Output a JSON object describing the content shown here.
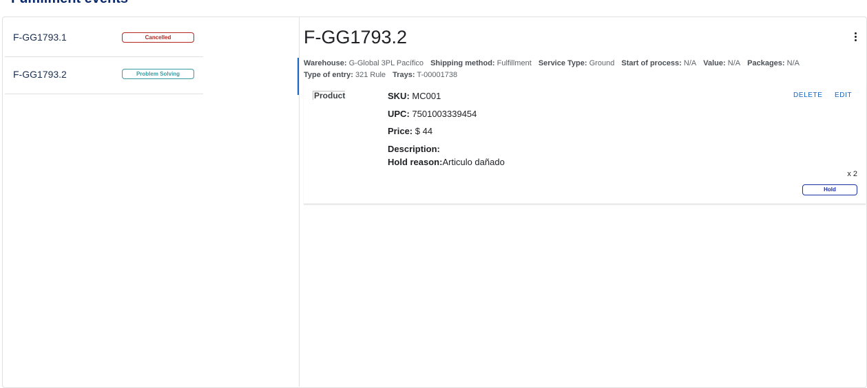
{
  "page": {
    "title": "Fulfillment events"
  },
  "list": {
    "items": [
      {
        "id": "F-GG1793.1",
        "status": "Cancelled"
      },
      {
        "id": "F-GG1793.2",
        "status": "Problem Solving"
      }
    ]
  },
  "detail": {
    "title": "F-GG1793.2",
    "meta": {
      "warehouse_label": "Warehouse:",
      "warehouse": "G-Global 3PL Pacífico",
      "shipping_label": "Shipping method:",
      "shipping": "Fulfillment",
      "service_label": "Service Type:",
      "service": "Ground",
      "start_label": "Start of process:",
      "start": "N/A",
      "value_label": "Value:",
      "value": "N/A",
      "packages_label": "Packages:",
      "packages": "N/A",
      "entry_label": "Type of entry:",
      "entry": "321 Rule",
      "trays_label": "Trays:",
      "trays": "T-00001738"
    },
    "product": {
      "image_alt": "Product",
      "sku_label": "SKU:",
      "sku": "MC001",
      "upc_label": "UPC:",
      "upc": "7501003339454",
      "price_label": "Price:",
      "price": "$ 44",
      "description_label": "Description:",
      "description": "",
      "hold_reason_label": "Hold reason:",
      "hold_reason": "Articulo dañado",
      "quantity": "x 2",
      "status": "Hold",
      "delete_label": "DELETE",
      "edit_label": "EDIT"
    }
  },
  "icons": {
    "menu": "more-vert-icon"
  },
  "colors": {
    "accent": "#1565c0",
    "cancelled": "#b3261e",
    "problem": "#3a9aa0",
    "hold": "#1a2ea6",
    "title": "#0b2a6b"
  }
}
